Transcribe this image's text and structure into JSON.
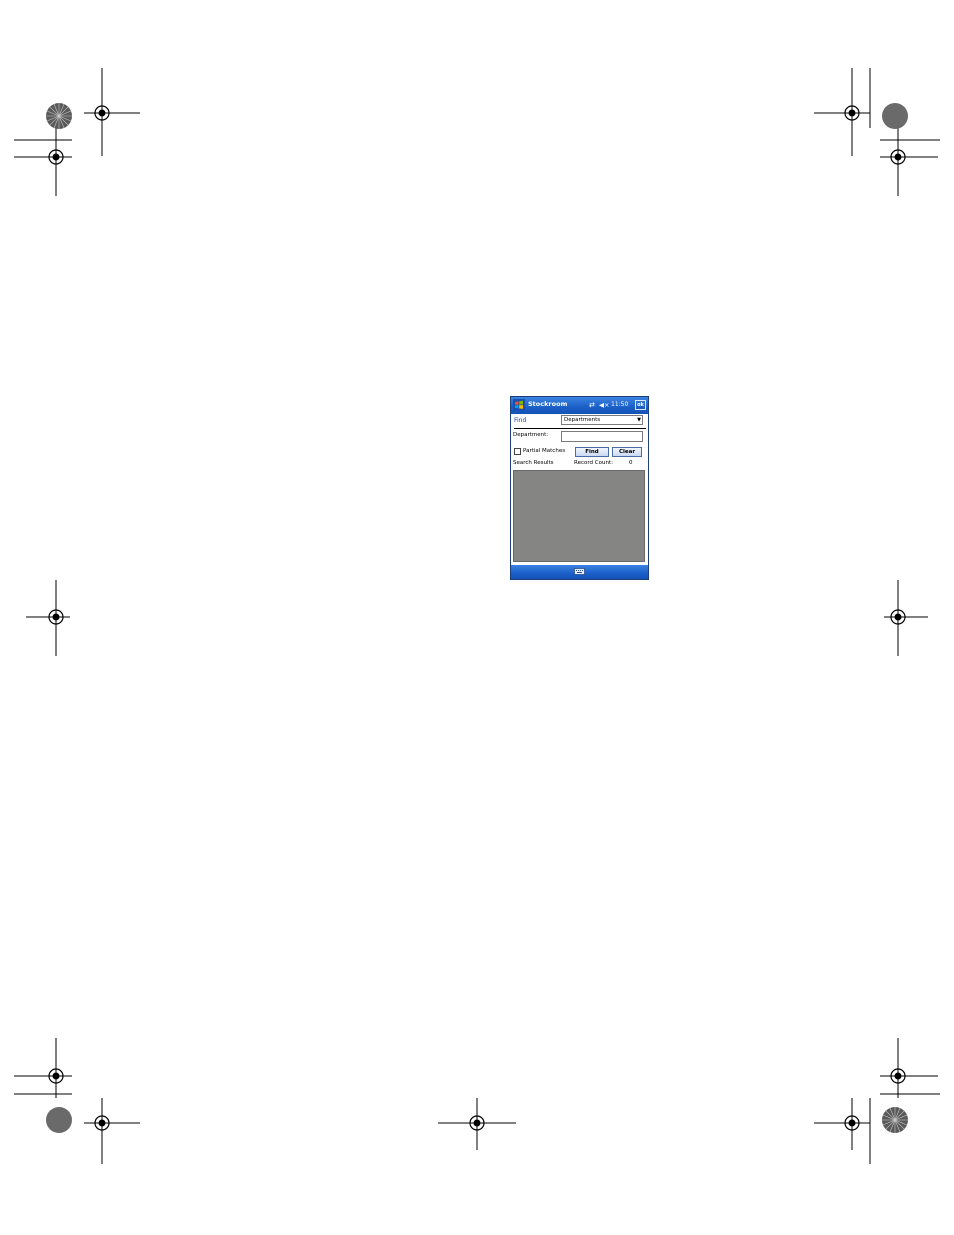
{
  "window": {
    "title": "Stockroom",
    "clock": "11:50",
    "ok_label": "ok"
  },
  "find": {
    "label": "Find",
    "selected_option": "Departments"
  },
  "form": {
    "department_label": "Department:",
    "department_value": "",
    "partial_matches_label": "Partial Matches",
    "partial_matches_checked": false,
    "find_button": "Find",
    "clear_button": "Clear"
  },
  "results": {
    "search_results_label": "Search Results",
    "record_count_label": "Record Count:",
    "record_count": "0"
  },
  "icons": {
    "start": "windows-flag-icon",
    "connectivity": "connectivity-icon",
    "volume": "volume-muted-icon",
    "keyboard": "keyboard-icon"
  },
  "colors": {
    "titlebar": "#1b5fc8",
    "results_background": "#858683",
    "link_text": "#1a3ca8"
  }
}
